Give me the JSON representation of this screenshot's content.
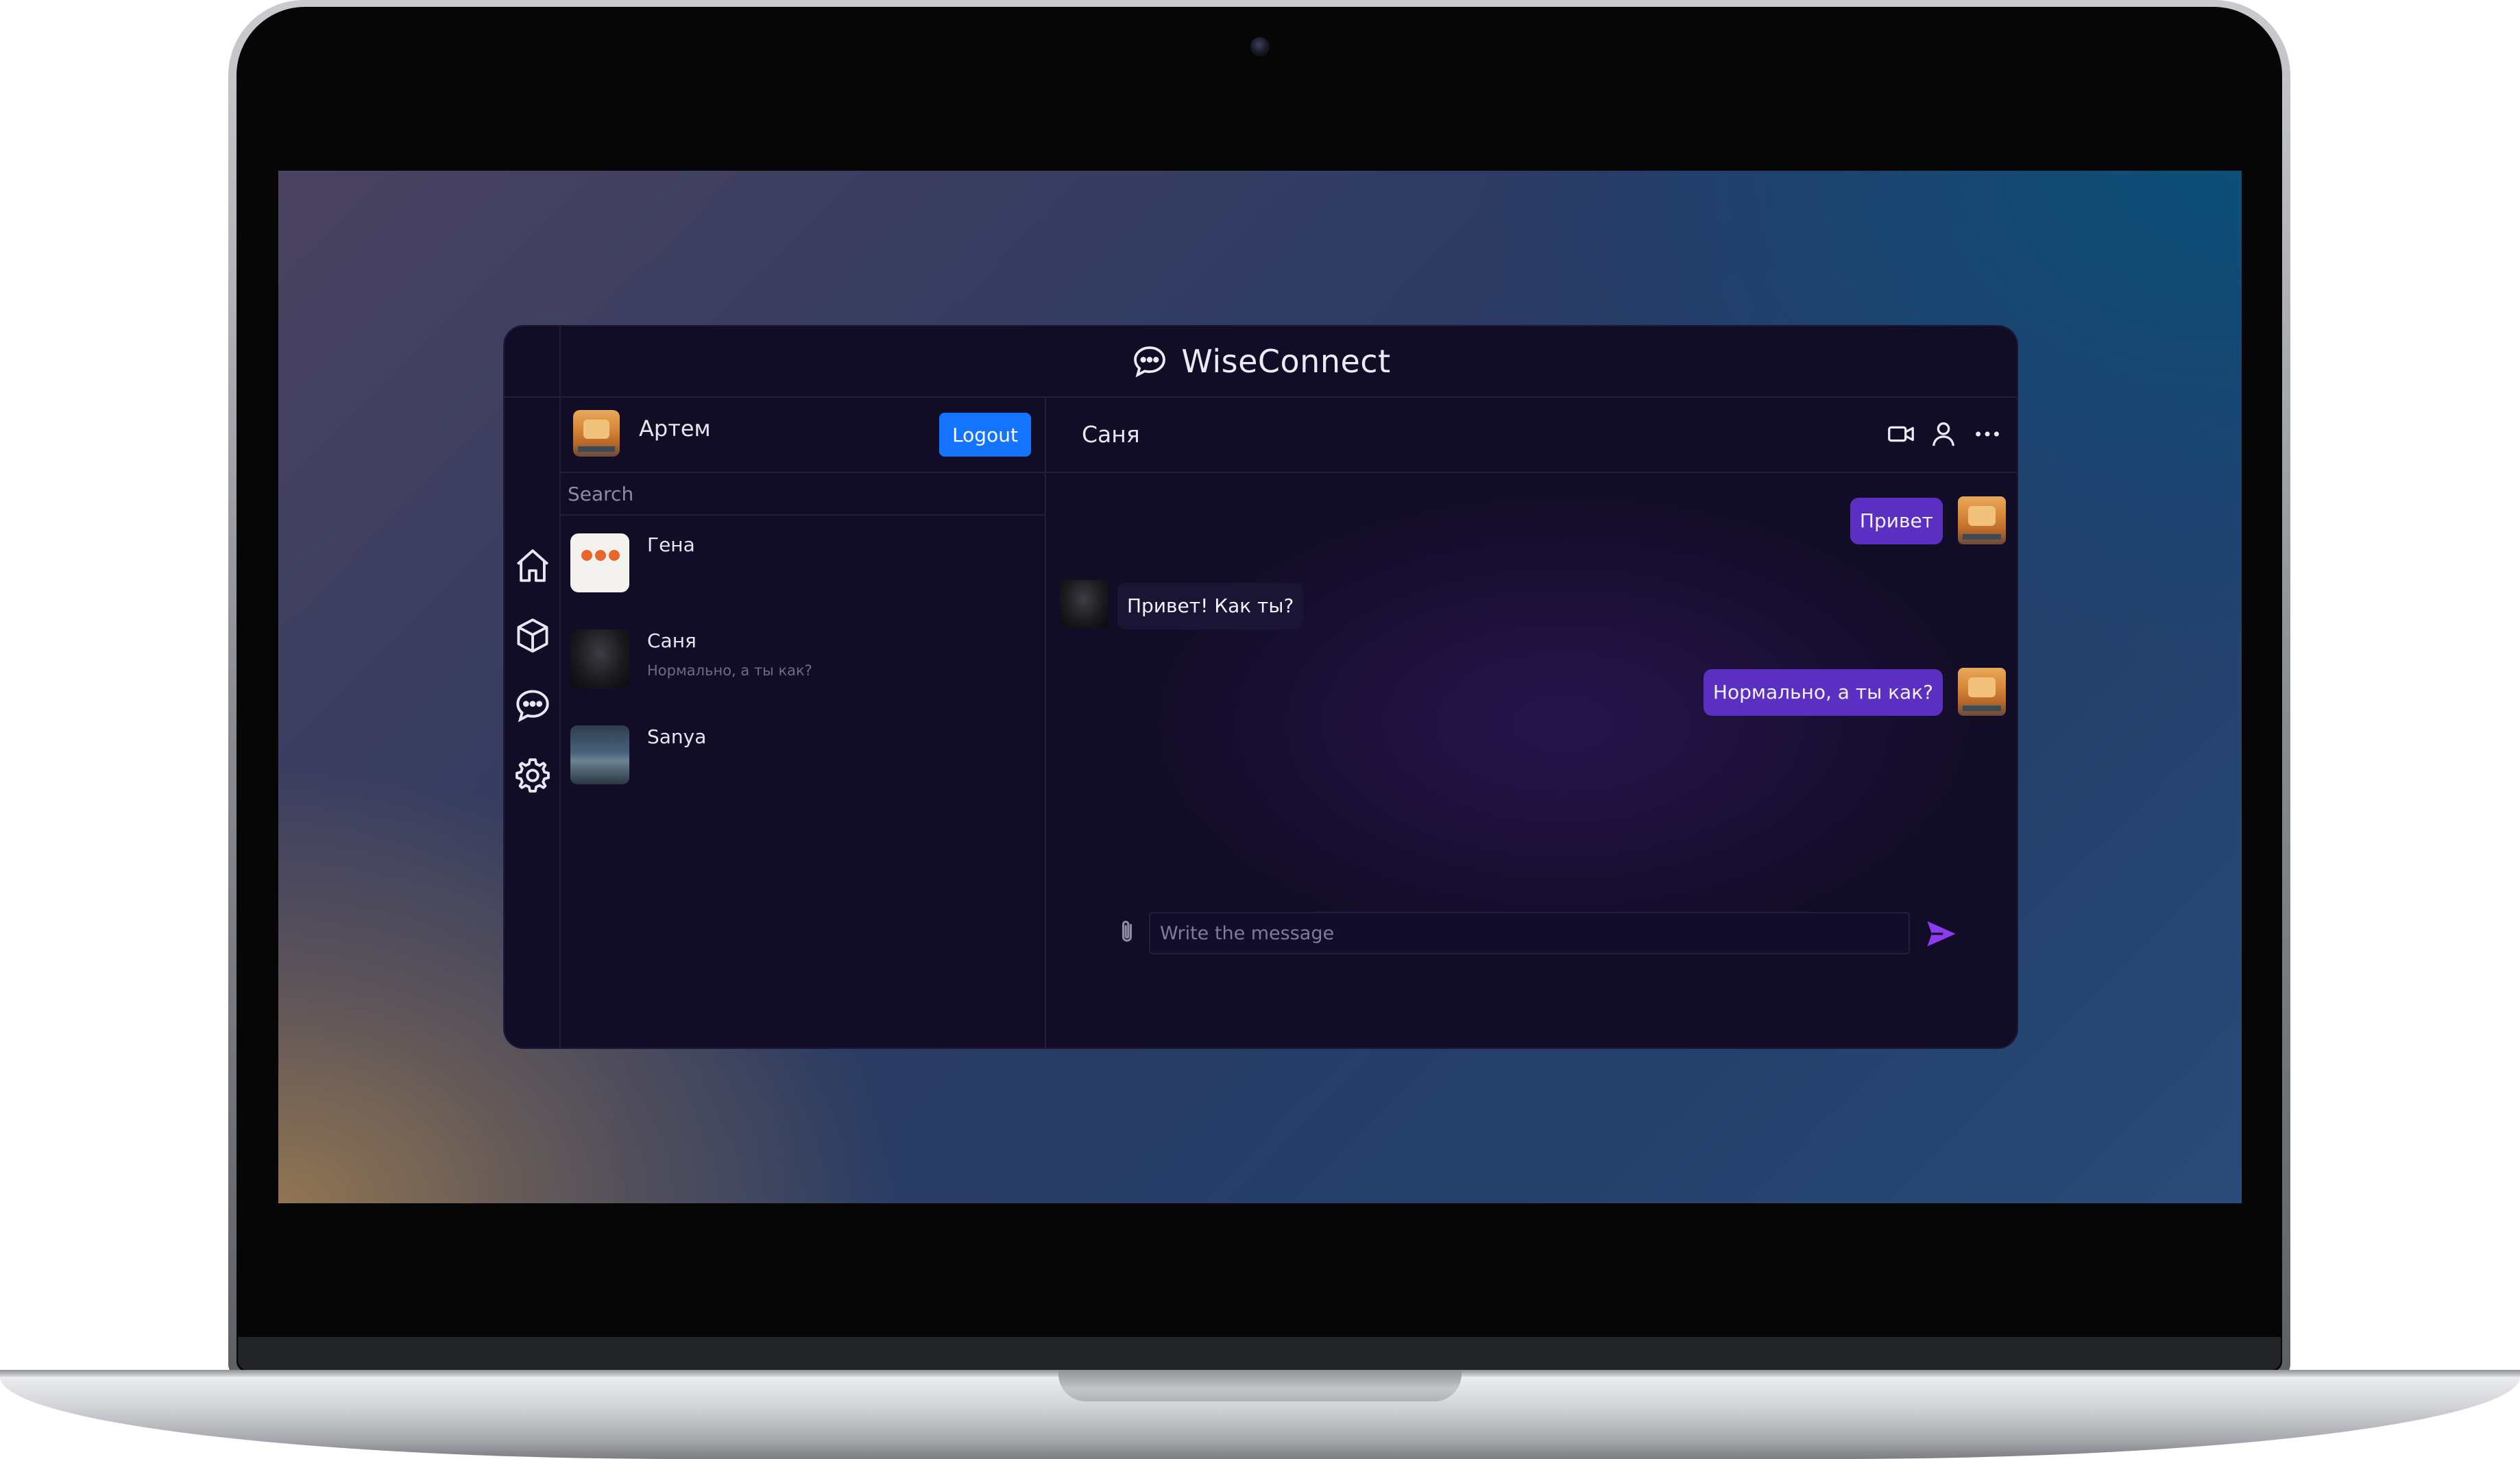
{
  "app": {
    "title": "WiseConnect",
    "logo_icon": "chat-bubble-icon"
  },
  "nav": {
    "items": [
      {
        "icon": "home-icon"
      },
      {
        "icon": "cube-icon"
      },
      {
        "icon": "chat-icon"
      },
      {
        "icon": "gear-icon"
      }
    ]
  },
  "profile": {
    "name": "Артем",
    "logout_label": "Logout"
  },
  "search": {
    "placeholder": "Search",
    "value": ""
  },
  "contacts": [
    {
      "name": "Гена",
      "preview": ""
    },
    {
      "name": "Саня",
      "preview": "Нормально, а ты как?"
    },
    {
      "name": "Sanya",
      "preview": ""
    }
  ],
  "chat": {
    "title": "Саня",
    "header_icons": [
      "video-camera-icon",
      "user-icon",
      "more-icon"
    ],
    "messages": [
      {
        "from": "me",
        "text": "Привет"
      },
      {
        "from": "them",
        "text": "Привет! Как ты?"
      },
      {
        "from": "me",
        "text": "Нормально, а ты как?"
      }
    ],
    "composer": {
      "placeholder": "Write the message",
      "value": ""
    }
  },
  "colors": {
    "accent_button": "#1473ff",
    "outgoing_bubble": "#5a2fc1",
    "send_icon": "#8b3cf0",
    "app_background": "#120d26"
  }
}
